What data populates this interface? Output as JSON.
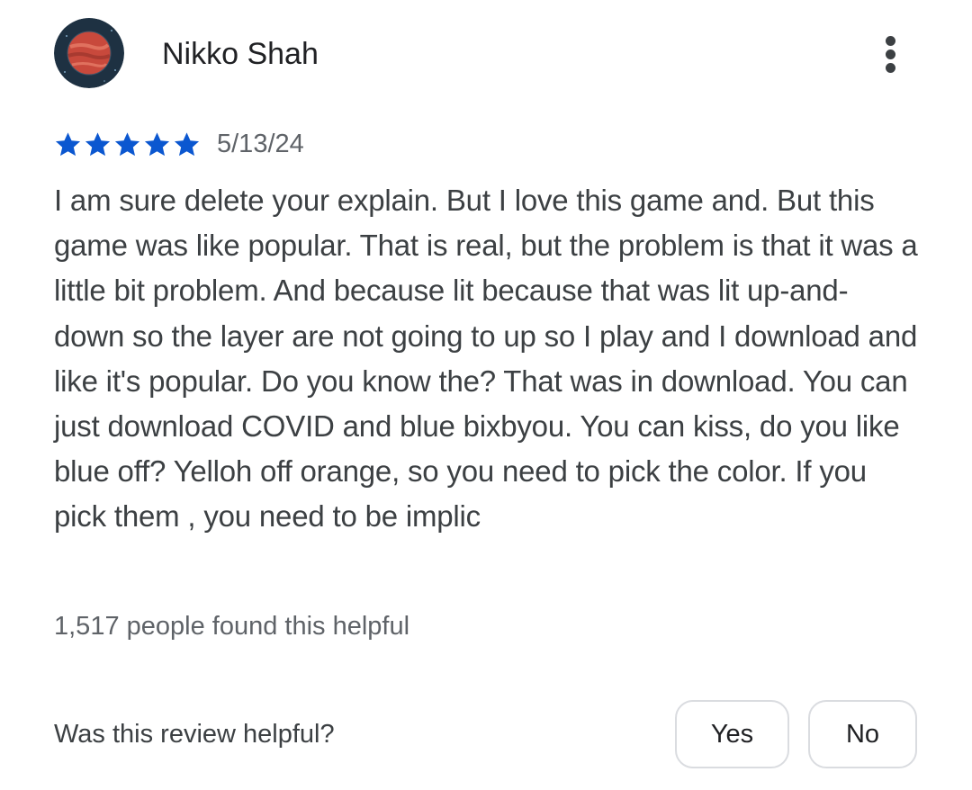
{
  "review": {
    "author": "Nikko Shah",
    "rating": 5,
    "max_rating": 5,
    "date": "5/13/24",
    "text": "I am sure delete your explain. But I love this game and. But this game was like popular. That is real, but the problem is that it was a little bit problem. And because lit because that was lit up-and-down so the layer are not going to up so I play and I download and like it's popular. Do you know the? That was in download. You can just download COVID and blue bixbyou. You can kiss, do you like blue off? Yelloh off orange, so you need to pick the color. If you pick them , you need to be implic",
    "helpful_count_text": "1,517 people found this helpful"
  },
  "feedback": {
    "question": "Was this review helpful?",
    "yes_label": "Yes",
    "no_label": "No"
  },
  "icons": {
    "avatar": "planet-avatar-icon",
    "menu": "more-vert-icon",
    "star": "star-icon"
  },
  "colors": {
    "star": "#0b57d0",
    "button_border": "#dadce0",
    "secondary_text": "#5f6368",
    "body_text": "#3c4043"
  }
}
